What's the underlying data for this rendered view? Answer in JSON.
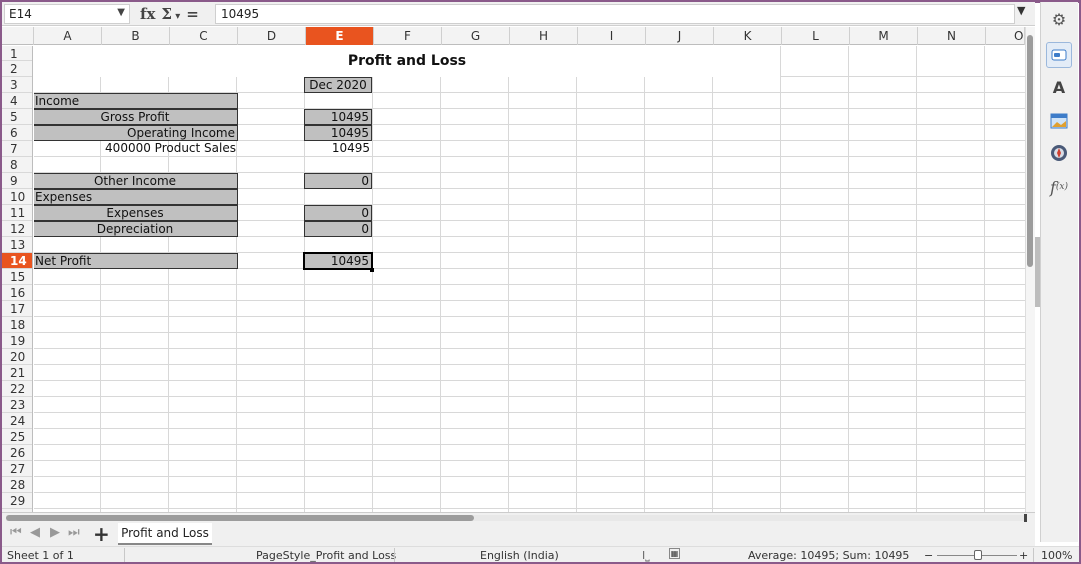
{
  "formula_bar": {
    "name_box": "E14",
    "fx_icon": "fx",
    "sum_icon": "Σ",
    "equals_icon": "=",
    "content": "10495"
  },
  "columns": [
    "A",
    "B",
    "C",
    "D",
    "E",
    "F",
    "G",
    "H",
    "I",
    "J",
    "K",
    "L",
    "M",
    "N",
    "O"
  ],
  "active_column": "E",
  "rows": [
    "1",
    "2",
    "3",
    "4",
    "5",
    "6",
    "7",
    "8",
    "9",
    "10",
    "11",
    "12",
    "13",
    "14",
    "15",
    "16",
    "17",
    "18",
    "19",
    "20",
    "21",
    "22",
    "23",
    "24",
    "25",
    "26",
    "27",
    "28",
    "29"
  ],
  "active_row": "14",
  "sheet": {
    "title": "Profit and Loss",
    "period": "Dec 2020",
    "income_label": "Income",
    "gross_profit_label": "Gross Profit",
    "gross_profit_value": "10495",
    "operating_income_label": "Operating Income",
    "operating_income_value": "10495",
    "product_sales_label": "400000 Product Sales",
    "product_sales_value": "10495",
    "other_income_label": "Other Income",
    "other_income_value": "0",
    "expenses_header": "Expenses",
    "expenses_label": "Expenses",
    "expenses_value": "0",
    "depreciation_label": "Depreciation",
    "depreciation_value": "0",
    "net_profit_label": "Net Profit",
    "net_profit_value": "10495"
  },
  "tabs": {
    "active": "Profit and Loss"
  },
  "status": {
    "sheet_pos": "Sheet 1 of 1",
    "page_style": "PageStyle_Profit and Loss",
    "language": "English (India)",
    "summary": "Average: 10495; Sum: 10495",
    "zoom_minus": "−",
    "zoom_plus": "+",
    "zoom": "100%"
  },
  "colors": {
    "accent": "#e9541f",
    "cell_fill": "#c0c0c0",
    "frame": "#8a5a8a"
  }
}
